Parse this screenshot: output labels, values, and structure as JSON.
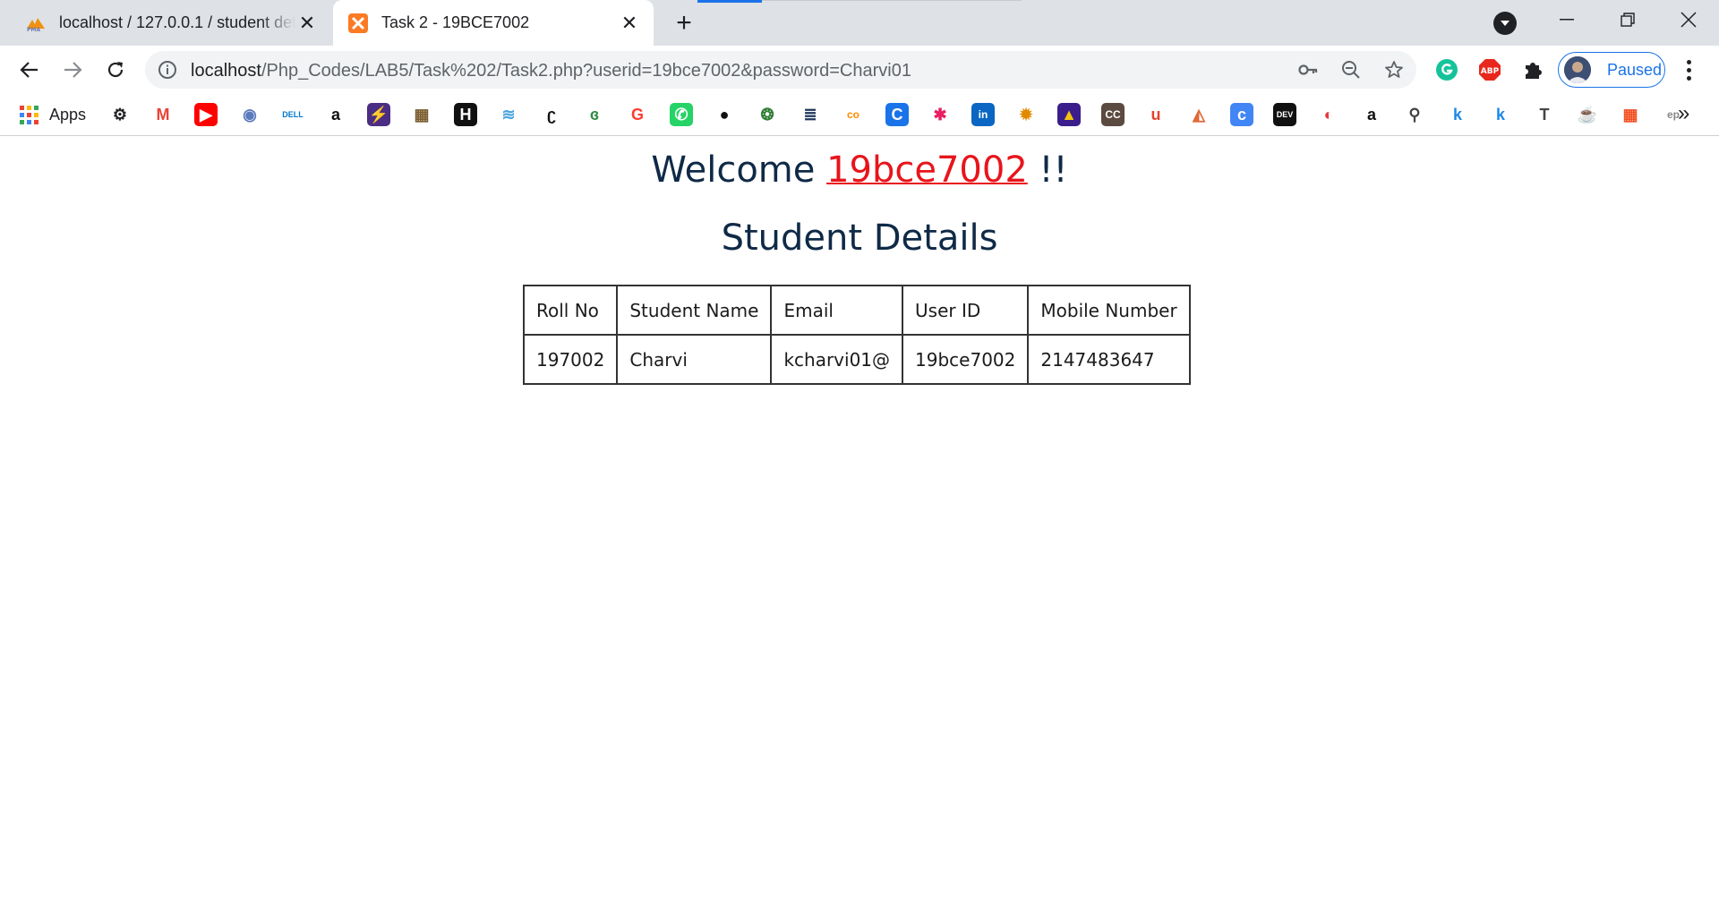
{
  "browser": {
    "tabs": [
      {
        "title": "localhost / 127.0.0.1 / student details",
        "favicon": "phpmyadmin-icon",
        "active": false
      },
      {
        "title": "Task 2 - 19BCE7002",
        "favicon": "xampp-icon",
        "active": true
      }
    ],
    "new_tab_label": "+",
    "address": {
      "host": "localhost",
      "path": "/Php_Codes/LAB5/Task%202/Task2.php?userid=19bce7002&password=Charvi01"
    },
    "profile_label": "Paused",
    "bookmarks": {
      "apps_label": "Apps",
      "items": [
        {
          "icon": "settings-icon",
          "glyph": "⚙",
          "color": "#202124"
        },
        {
          "icon": "gmail-icon",
          "glyph": "M",
          "color": "#ea4335"
        },
        {
          "icon": "youtube-icon",
          "glyph": "▶",
          "color": "#ffffff",
          "bg": "#ff0000"
        },
        {
          "icon": "university-icon",
          "glyph": "◉",
          "color": "#5b7bbd"
        },
        {
          "icon": "dell-icon",
          "glyph": "DELL",
          "color": "#0076ce"
        },
        {
          "icon": "amazon-icon",
          "glyph": "a",
          "color": "#111111"
        },
        {
          "icon": "bolt-icon",
          "glyph": "⚡",
          "color": "#ffffff",
          "bg": "#4b2e83"
        },
        {
          "icon": "picture-icon",
          "glyph": "▦",
          "color": "#7a5c2e"
        },
        {
          "icon": "hackerrank-icon",
          "glyph": "H",
          "color": "#ffffff",
          "bg": "#111111"
        },
        {
          "icon": "wave-icon",
          "glyph": "≋",
          "color": "#4aa3df"
        },
        {
          "icon": "codechef-icon",
          "glyph": "ʗ",
          "color": "#111111"
        },
        {
          "icon": "geeksforgeeks-icon",
          "glyph": "ɞ",
          "color": "#2f8d46"
        },
        {
          "icon": "grammarly-g-icon",
          "glyph": "G",
          "color": "#ff3b30"
        },
        {
          "icon": "whatsapp-icon",
          "glyph": "✆",
          "color": "#ffffff",
          "bg": "#25d366"
        },
        {
          "icon": "github-icon",
          "glyph": "●",
          "color": "#111111"
        },
        {
          "icon": "leaf-icon",
          "glyph": "❂",
          "color": "#2e7d32"
        },
        {
          "icon": "stack-icon",
          "glyph": "≣",
          "color": "#1d3557"
        },
        {
          "icon": "coursera-icon",
          "glyph": "co",
          "color": "#ff8c00"
        },
        {
          "icon": "c-icon",
          "glyph": "C",
          "color": "#ffffff",
          "bg": "#1a73e8"
        },
        {
          "icon": "asterisk-icon",
          "glyph": "✱",
          "color": "#e91e63"
        },
        {
          "icon": "linkedin-icon",
          "glyph": "in",
          "color": "#ffffff",
          "bg": "#0a66c2"
        },
        {
          "icon": "bug-icon",
          "glyph": "✹",
          "color": "#e08a00"
        },
        {
          "icon": "chart-icon",
          "glyph": "▲",
          "color": "#f4c20d",
          "bg": "#3b1e8c"
        },
        {
          "icon": "cc-icon",
          "glyph": "CC",
          "color": "#ffffff",
          "bg": "#5b4a3f"
        },
        {
          "icon": "udemy-icon",
          "glyph": "u",
          "color": "#e8412c"
        },
        {
          "icon": "matlab-icon",
          "glyph": "◭",
          "color": "#e16737"
        },
        {
          "icon": "c-circle-icon",
          "glyph": "c",
          "color": "#ffffff",
          "bg": "#4285f4"
        },
        {
          "icon": "dev-icon",
          "glyph": "DEV",
          "color": "#ffffff",
          "bg": "#111111"
        },
        {
          "icon": "record-icon",
          "glyph": "◐",
          "color": "#e03a3e"
        },
        {
          "icon": "amazon-icon",
          "glyph": "a",
          "color": "#111111"
        },
        {
          "icon": "magnifier-icon",
          "glyph": "⚲",
          "color": "#444444"
        },
        {
          "icon": "k-icon",
          "glyph": "k",
          "color": "#1e88e5"
        },
        {
          "icon": "k-icon",
          "glyph": "k",
          "color": "#1e88e5"
        },
        {
          "icon": "t-icon",
          "glyph": "T",
          "color": "#444444"
        },
        {
          "icon": "java-cup-icon",
          "glyph": "☕",
          "color": "#444444"
        },
        {
          "icon": "microsoft-icon",
          "glyph": "▦",
          "color": "#f25022"
        },
        {
          "icon": "ep-icon",
          "glyph": "ep",
          "color": "#888888"
        }
      ]
    }
  },
  "page": {
    "welcome_prefix": "Welcome",
    "user_id": "19bce7002",
    "welcome_suffix": "!!",
    "heading": "Student Details",
    "table": {
      "columns": [
        "Roll No",
        "Student Name",
        "Email",
        "User ID",
        "Mobile Number"
      ],
      "rows": [
        [
          "197002",
          "Charvi",
          "kcharvi01@",
          "19bce7002",
          "2147483647"
        ]
      ]
    }
  },
  "colors": {
    "accent": "#1a73e8",
    "heading": "#0f2a47",
    "user_id_link": "#e8141b"
  }
}
